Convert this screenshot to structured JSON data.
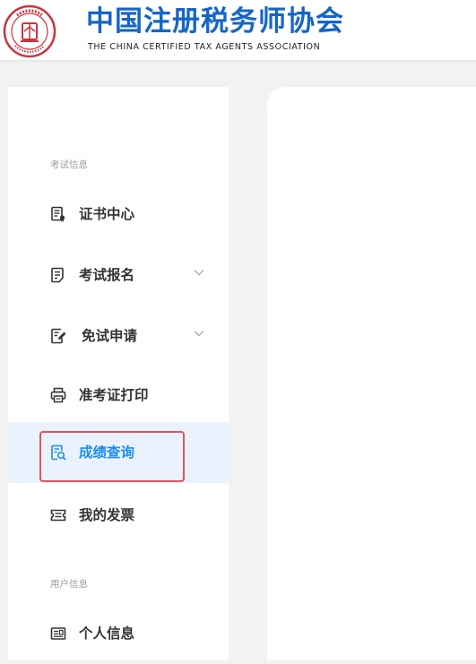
{
  "header": {
    "brand_cn": "中国注册税务师协会",
    "brand_en": "THE CHINA CERTIFIED TAX AGENTS ASSOCIATION",
    "logo_icon": "association-seal-logo",
    "logo_text": "中国注册税务师协会 CHINA CERTIFIED TAX AGENTS ASSOCIATION"
  },
  "sidebar": {
    "sections": [
      {
        "label": "考试信息"
      },
      {
        "label": "用户信息"
      }
    ],
    "items": [
      {
        "label": "证书中心",
        "icon": "certificate-icon",
        "has_submenu": false,
        "active": false
      },
      {
        "label": "考试报名",
        "icon": "registration-form-icon",
        "has_submenu": true,
        "active": false
      },
      {
        "label": "免试申请",
        "icon": "edit-document-icon",
        "has_submenu": true,
        "active": false
      },
      {
        "label": "准考证打印",
        "icon": "printer-icon",
        "has_submenu": false,
        "active": false
      },
      {
        "label": "成绩查询",
        "icon": "score-search-icon",
        "has_submenu": false,
        "active": true
      },
      {
        "label": "我的发票",
        "icon": "invoice-ticket-icon",
        "has_submenu": false,
        "active": false
      },
      {
        "label": "个人信息",
        "icon": "id-card-icon",
        "has_submenu": false,
        "active": false
      }
    ]
  },
  "colors": {
    "brand_blue": "#1565c8",
    "active_text": "#1d8cf0",
    "active_bg": "#eaf3fd",
    "highlight_border": "#e8515b",
    "page_bg": "#f2f2f2"
  }
}
